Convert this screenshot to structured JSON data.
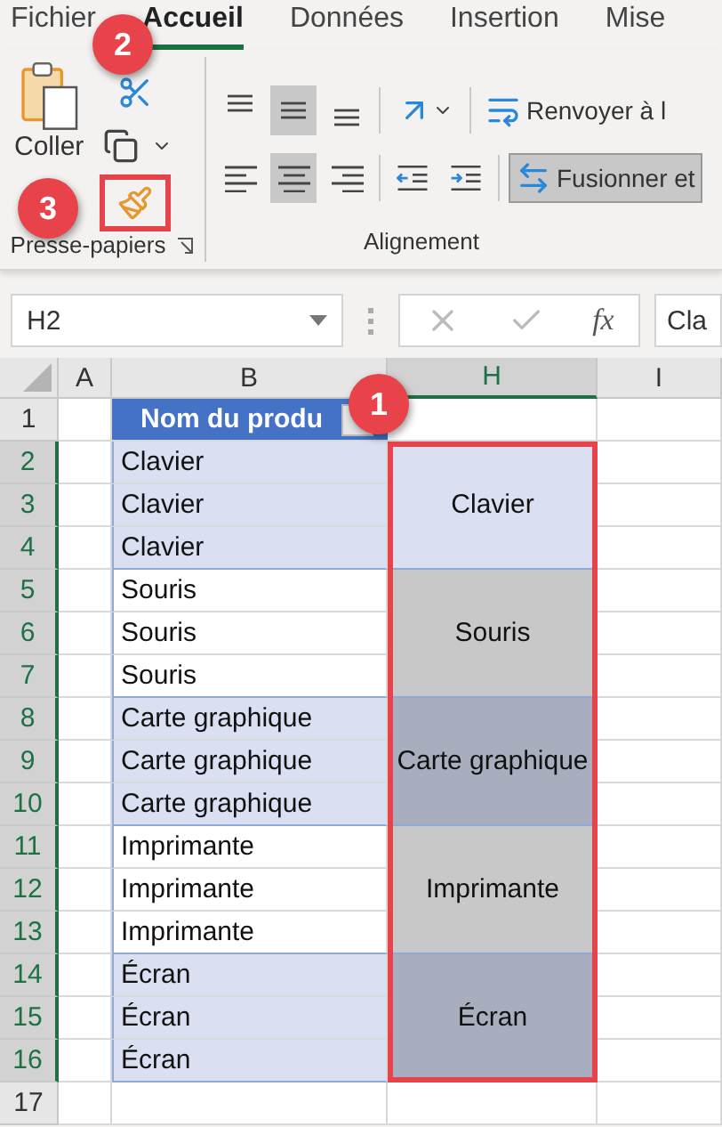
{
  "ribbon_tabs": [
    {
      "label": "Fichier",
      "selected": false
    },
    {
      "label": "Accueil",
      "selected": true
    },
    {
      "label": "Données",
      "selected": false
    },
    {
      "label": "Insertion",
      "selected": false
    },
    {
      "label": "Mise",
      "selected": false
    }
  ],
  "clipboard_group": {
    "paste_label": "Coller",
    "title": "Presse-papiers",
    "format_painter_highlighted": true
  },
  "alignment_group": {
    "title": "Alignement",
    "wrap_text_label": "Renvoyer à l",
    "merge_label": "Fusionner et",
    "vertical_align": [
      {
        "kind": "top",
        "selected": false
      },
      {
        "kind": "middle",
        "selected": true
      },
      {
        "kind": "bottom",
        "selected": false
      }
    ],
    "horizontal_align": [
      {
        "kind": "left",
        "selected": false
      },
      {
        "kind": "center",
        "selected": true
      },
      {
        "kind": "right",
        "selected": false
      }
    ]
  },
  "formula_bar": {
    "name_box": "H2",
    "function_label": "fx",
    "value": "Cla"
  },
  "columns": [
    {
      "label": "A",
      "selected": false
    },
    {
      "label": "B",
      "selected": false
    },
    {
      "label": "H",
      "selected": true
    },
    {
      "label": "I",
      "selected": false
    }
  ],
  "table_header": "Nom du produ",
  "groups": [
    {
      "merged": "Clavier",
      "color": "#dae0f2",
      "banded": true,
      "rows": [
        {
          "row": "2",
          "cell": "Clavier"
        },
        {
          "row": "3",
          "cell": "Clavier"
        },
        {
          "row": "4",
          "cell": "Clavier"
        }
      ]
    },
    {
      "merged": "Souris",
      "color": "#c8c8c8",
      "banded": false,
      "rows": [
        {
          "row": "5",
          "cell": "Souris"
        },
        {
          "row": "6",
          "cell": "Souris"
        },
        {
          "row": "7",
          "cell": "Souris"
        }
      ]
    },
    {
      "merged": "Carte graphique",
      "color": "#a8aebd",
      "banded": true,
      "rows": [
        {
          "row": "8",
          "cell": "Carte graphique"
        },
        {
          "row": "9",
          "cell": "Carte graphique"
        },
        {
          "row": "10",
          "cell": "Carte graphique"
        }
      ]
    },
    {
      "merged": "Imprimante",
      "color": "#c8c8c8",
      "banded": false,
      "rows": [
        {
          "row": "11",
          "cell": "Imprimante"
        },
        {
          "row": "12",
          "cell": "Imprimante"
        },
        {
          "row": "13",
          "cell": "Imprimante"
        }
      ]
    },
    {
      "merged": "Écran",
      "color": "#a8aebd",
      "banded": true,
      "rows": [
        {
          "row": "14",
          "cell": "Écran"
        },
        {
          "row": "15",
          "cell": "Écran"
        },
        {
          "row": "16",
          "cell": "Écran"
        }
      ]
    }
  ],
  "header_row": {
    "row": "1",
    "selected": false
  },
  "groups_rows_selected": true,
  "last_row": {
    "row": "17",
    "selected": false
  },
  "h_range_highlighted": true,
  "callouts": [
    "1",
    "2",
    "3"
  ]
}
